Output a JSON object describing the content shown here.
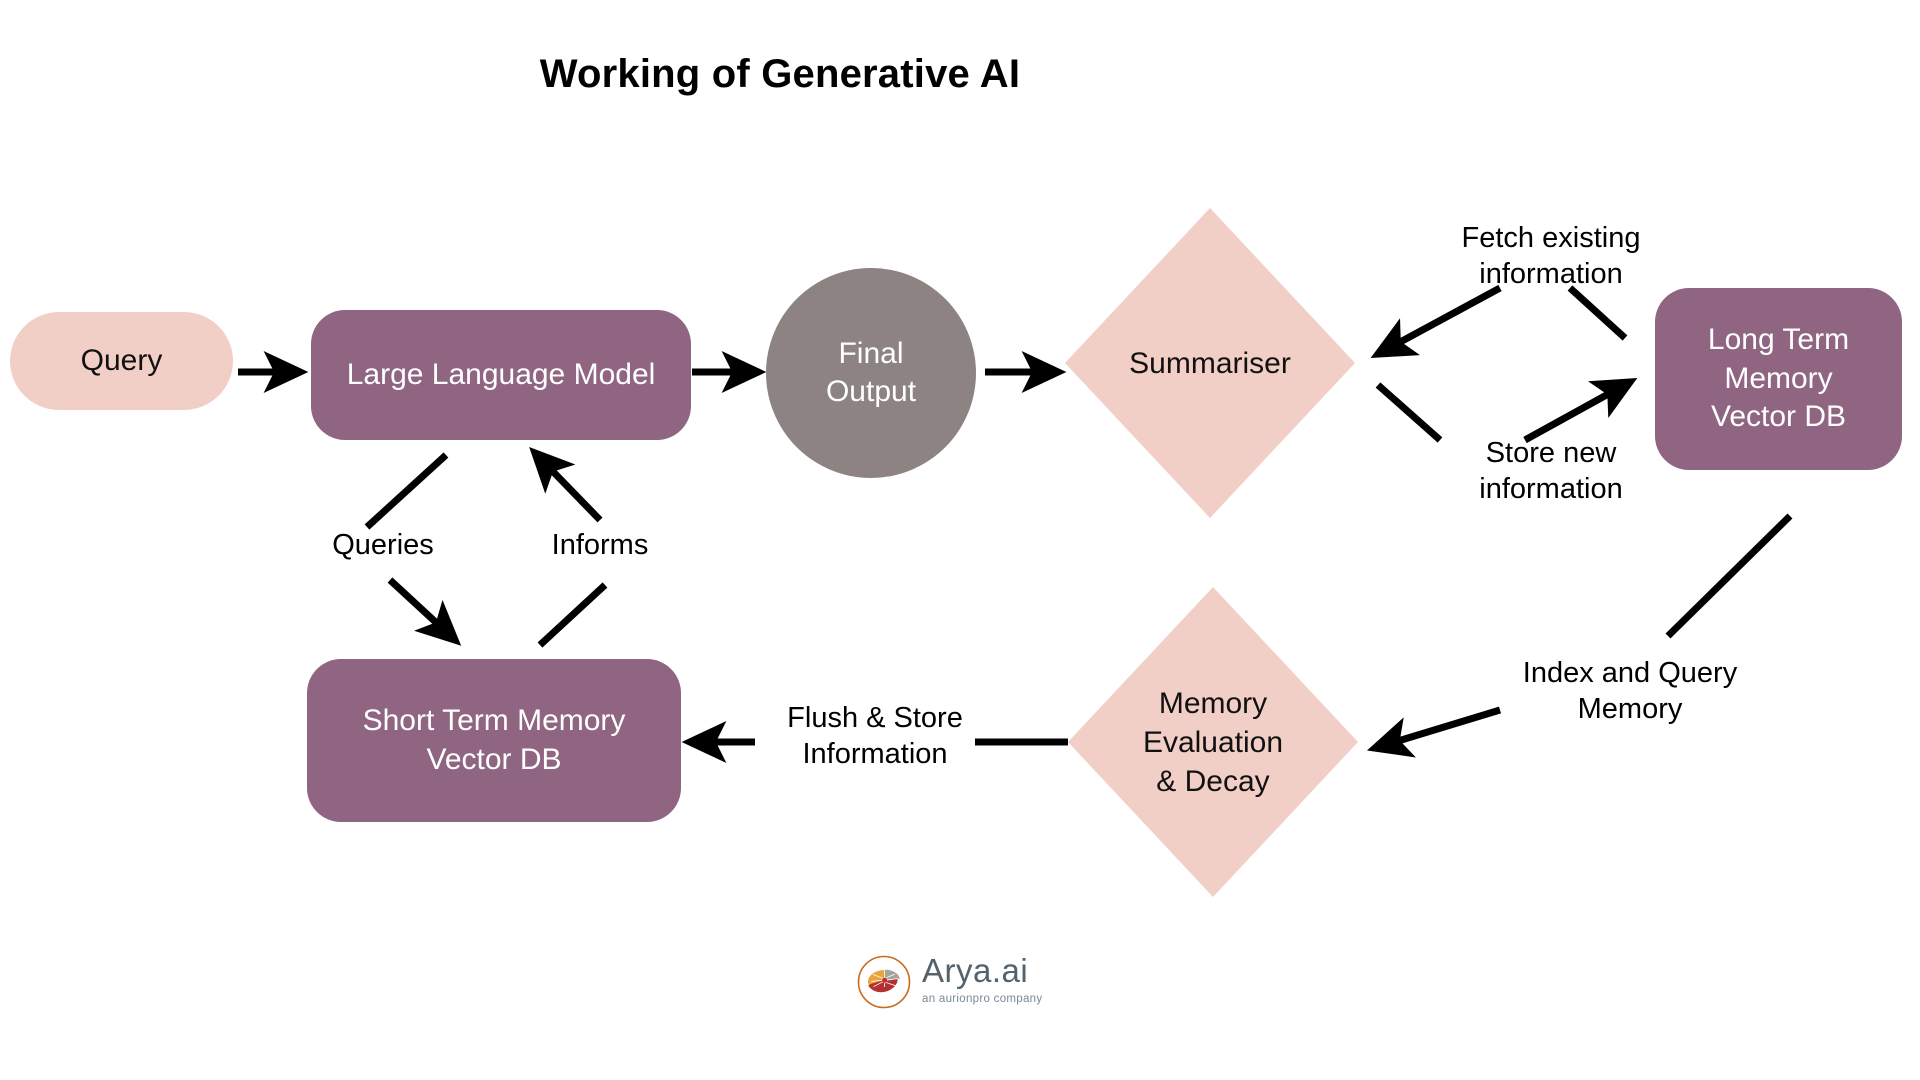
{
  "page": {
    "title": "Working of Generative AI",
    "background": "#ffffff"
  },
  "colors": {
    "pink": "#F2CFC6",
    "mauve": "#8F6581",
    "gray": "#8D8383",
    "arrow": "#000000",
    "text_dark": "#111111",
    "text_light": "#ffffff",
    "logo_word": "#53626d",
    "logo_tagline": "#7b8a95",
    "logo_ring": "#C96A1E"
  },
  "nodes": {
    "query": {
      "label": "Query",
      "shape": "pill",
      "fill": "#F2CFC6"
    },
    "llm": {
      "label": "Large Language Model",
      "shape": "rounded-rect",
      "fill": "#8F6581"
    },
    "final_output": {
      "label": "Final\nOutput",
      "line1": "Final",
      "line2": "Output",
      "shape": "circle",
      "fill": "#8D8383"
    },
    "summariser": {
      "label": "Summariser",
      "shape": "diamond",
      "fill": "#F2CFC6"
    },
    "long_term_memory": {
      "line1": "Long Term",
      "line2": "Memory",
      "line3": "Vector DB",
      "shape": "rounded-rect",
      "fill": "#8F6581"
    },
    "short_term_memory": {
      "line1": "Short Term Memory",
      "line2": "Vector DB",
      "shape": "rounded-rect",
      "fill": "#8F6581"
    },
    "memory_evaluation": {
      "line1": "Memory",
      "line2": "Evaluation",
      "line3": "& Decay",
      "shape": "diamond",
      "fill": "#F2CFC6"
    }
  },
  "edges": [
    {
      "id": "query-to-llm",
      "from": "query",
      "to": "llm",
      "label": ""
    },
    {
      "id": "llm-to-final-output",
      "from": "llm",
      "to": "final_output",
      "label": ""
    },
    {
      "id": "final-output-to-summariser",
      "from": "final_output",
      "to": "summariser",
      "label": ""
    },
    {
      "id": "llm-to-short-term-memory",
      "from": "llm",
      "to": "short_term_memory",
      "label": "Queries"
    },
    {
      "id": "short-term-memory-to-llm",
      "from": "short_term_memory",
      "to": "llm",
      "label": "Informs"
    },
    {
      "id": "long-term-memory-to-summariser",
      "from": "long_term_memory",
      "to": "summariser",
      "label": "Fetch existing\ninformation"
    },
    {
      "id": "summariser-to-long-term-memory",
      "from": "summariser",
      "to": "long_term_memory",
      "label": "Store new\ninformation"
    },
    {
      "id": "long-term-memory-to-memory-evaluation",
      "from": "long_term_memory",
      "to": "memory_evaluation",
      "label": "Index and Query\nMemory"
    },
    {
      "id": "memory-evaluation-to-short-term-memory",
      "from": "memory_evaluation",
      "to": "short_term_memory",
      "label": "Flush & Store\nInformation"
    }
  ],
  "edge_labels": {
    "queries": "Queries",
    "informs": "Informs",
    "fetch_existing": "Fetch existing\ninformation",
    "store_new": "Store new\ninformation",
    "index_query": "Index and Query\nMemory",
    "flush_store": "Flush & Store\nInformation"
  },
  "logo": {
    "wordmark": "Arya.ai",
    "tagline": "an aurionpro company",
    "mark": "brain-circle-icon"
  }
}
